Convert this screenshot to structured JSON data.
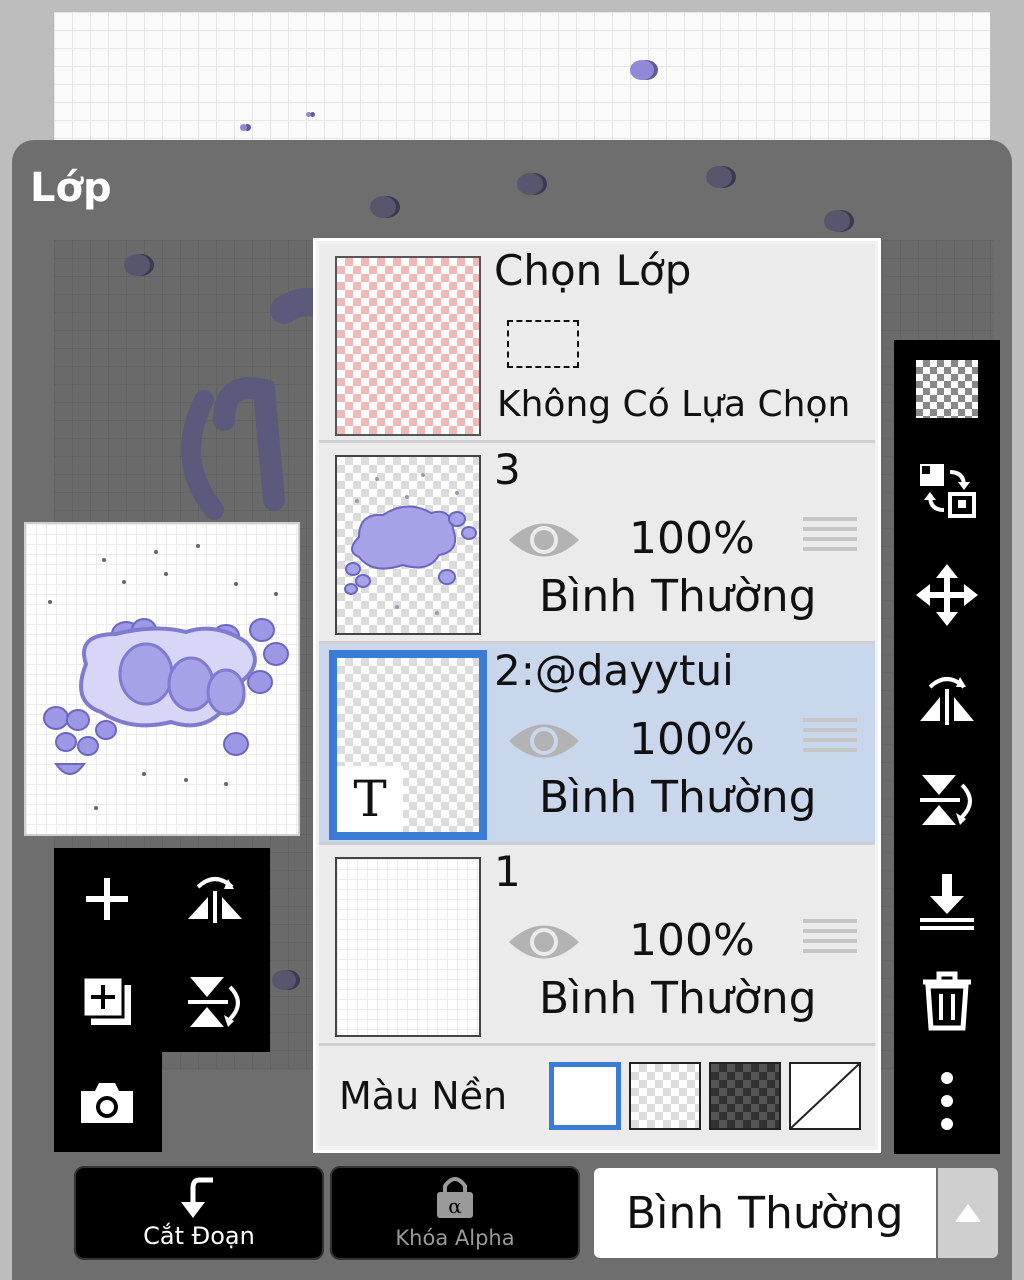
{
  "panel": {
    "title": "Lớp"
  },
  "selection_layer": {
    "title": "Chọn Lớp",
    "status": "Không Có Lựa Chọn"
  },
  "layers": [
    {
      "name": "3",
      "opacity": "100%",
      "blend": "Bình Thường",
      "selected": false
    },
    {
      "name": "2:@dayytui",
      "opacity": "100%",
      "blend": "Bình Thường",
      "selected": true,
      "type_badge": "T"
    },
    {
      "name": "1",
      "opacity": "100%",
      "blend": "Bình Thường",
      "selected": false
    }
  ],
  "background": {
    "label": "Màu Nền",
    "options": [
      "white",
      "transparent",
      "dark-checker",
      "none"
    ],
    "selected": "white"
  },
  "bottom_bar": {
    "clip_label": "Cắt Đoạn",
    "alpha_lock_label": "Khóa Alpha",
    "blend_mode": "Bình Thường"
  },
  "colors": {
    "selected_layer": "#c9d7ec",
    "accent": "#3a7bd5"
  }
}
